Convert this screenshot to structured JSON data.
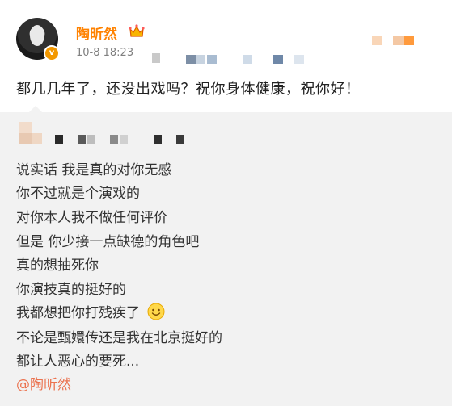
{
  "post": {
    "username": "陶昕然",
    "time": "10-8 18:23",
    "text": "都几几年了，还没出戏吗？祝你身体健康，祝你好！",
    "icons": {
      "avatar": "avatar",
      "verified": "verified-badge-icon",
      "crown": "crown-icon"
    },
    "colors": {
      "username": "#ff8200",
      "mention": "#eb7350",
      "repost_bg": "#f2f2f2"
    },
    "verified_badge": "v"
  },
  "repost": {
    "lines": [
      "说实话 我是真的对你无感",
      "你不过就是个演戏的",
      "对你本人我不做任何评价",
      "但是 你少接一点缺德的角色吧",
      "真的想抽死你",
      "你演技真的挺好的",
      "我都想把你打残疾了",
      "不论是甄嬛传还是我在北京挺好的",
      "都让人恶心的要死..."
    ],
    "emoji": "smile-emoji-icon",
    "mention": "@陶昕然"
  }
}
